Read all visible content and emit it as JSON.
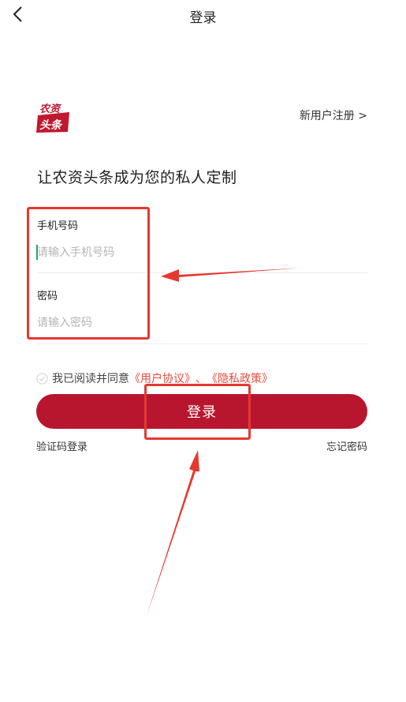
{
  "header": {
    "title": "登录",
    "back_icon": "chevron-left-icon"
  },
  "brand": {
    "logo_text_line1": "农资",
    "logo_text_line2": "头条",
    "logo_color": "#c0182f"
  },
  "register_link": "新用户注册 >",
  "headline": "让农资头条成为您的私人定制",
  "form": {
    "phone_label": "手机号码",
    "phone_placeholder": "请输入手机号码",
    "password_label": "密码",
    "password_placeholder": "请输入密码"
  },
  "agreement": {
    "prefix": "我已阅读并同意",
    "user_agreement": "《用户协议》",
    "separator": "、",
    "privacy_policy": "《隐私政策》"
  },
  "login_button": "登录",
  "sms_login": "验证码登录",
  "forgot_password": "忘记密码",
  "colors": {
    "primary": "#b8162f",
    "link": "#e64a3b",
    "annotation": "#e53930"
  }
}
